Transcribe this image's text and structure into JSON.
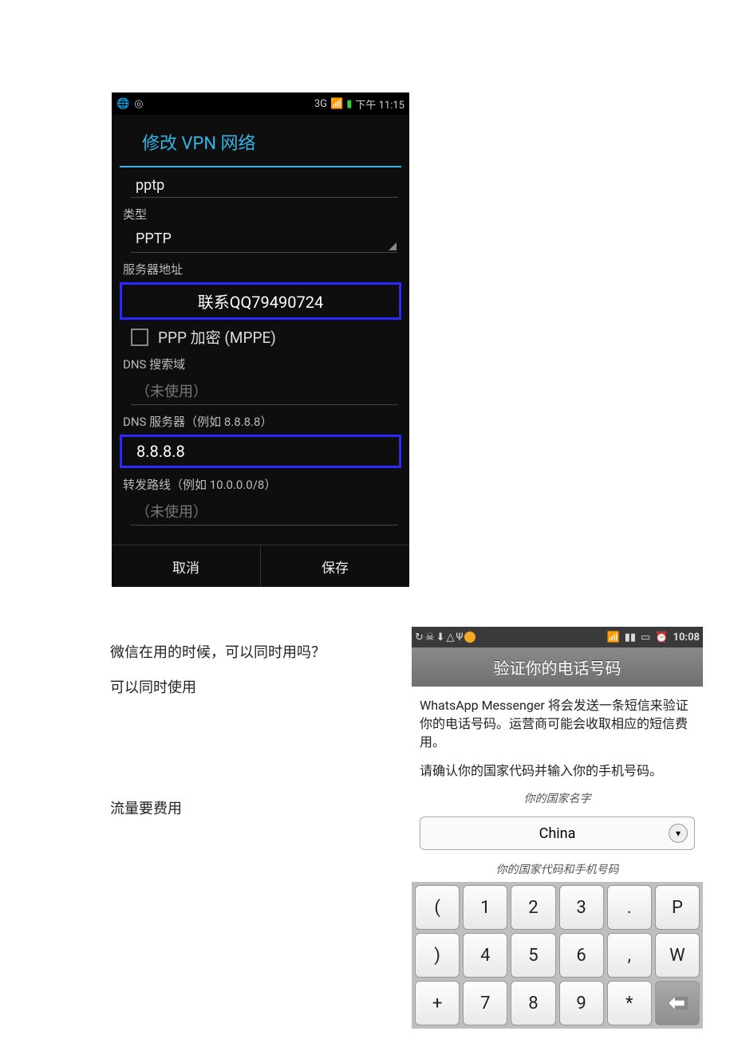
{
  "phone1": {
    "status": {
      "time": "下午 11:15",
      "signal3g": "3G"
    },
    "title": "修改 VPN 网络",
    "name_value": "pptp",
    "type_label": "类型",
    "type_value": "PPTP",
    "server_label": "服务器地址",
    "server_value": "联系QQ79490724",
    "ppp_label": "PPP 加密 (MPPE)",
    "dns_search_label": "DNS 搜索域",
    "unused_placeholder": "（未使用）",
    "dns_server_label": "DNS 服务器（例如 8.8.8.8）",
    "dns_server_value": "8.8.8.8",
    "route_label": "转发路线（例如 10.0.0.0/8）",
    "cancel": "取消",
    "save": "保存"
  },
  "doc": {
    "q1": "微信在用的时候，可以同时用吗？",
    "a1": "可以同时使用",
    "note": "流量要费用"
  },
  "phone2": {
    "status": {
      "time": "10:08"
    },
    "header": "验证你的电话号码",
    "body1": "WhatsApp Messenger 将会发送一条短信来验证你的电话号码。运营商可能会收取相应的短信费用。",
    "body2": "请确认你的国家代码并输入你的手机号码。",
    "country_label": "你的国家名字",
    "country_value": "China",
    "code_label": "你的国家代码和手机号码",
    "keys": {
      "r1": [
        "(",
        "1",
        "2",
        "3",
        ".",
        "P"
      ],
      "r2": [
        ")",
        "4",
        "5",
        "6",
        ",",
        "W"
      ],
      "r3": [
        "+",
        "7",
        "8",
        "9",
        "*"
      ]
    }
  }
}
